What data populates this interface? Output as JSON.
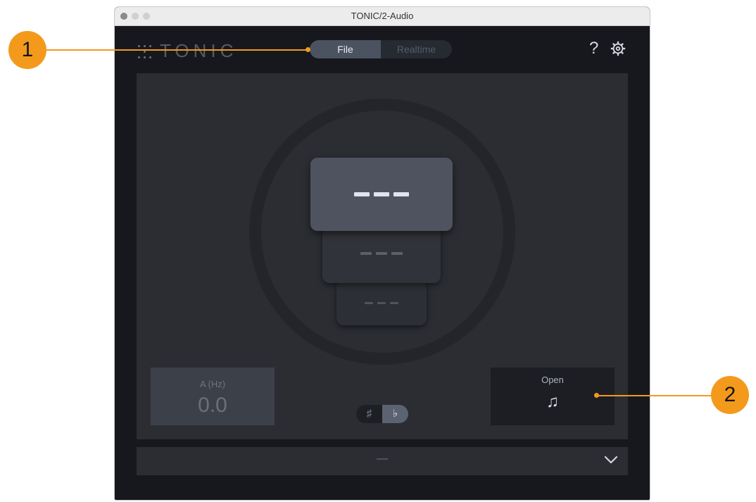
{
  "window": {
    "title": "TONIC/2-Audio"
  },
  "header": {
    "logo_text": "TONIC",
    "modes": [
      {
        "label": "File",
        "active": true
      },
      {
        "label": "Realtime",
        "active": false
      }
    ],
    "help_label": "?"
  },
  "main": {
    "frequency": {
      "label": "A (Hz)",
      "value": "0.0"
    },
    "accidentals": [
      {
        "label": "♯",
        "active": false
      },
      {
        "label": "♭",
        "active": true
      }
    ],
    "open": {
      "label": "Open",
      "icon": "music-note-icon",
      "glyph": "♫"
    }
  },
  "bottom_bar": {
    "text": "—"
  },
  "callouts": [
    {
      "label": "1"
    },
    {
      "label": "2"
    }
  ],
  "colors": {
    "accent": "#f39a1d",
    "background": "#16181d",
    "panel": "#2b2d33"
  }
}
